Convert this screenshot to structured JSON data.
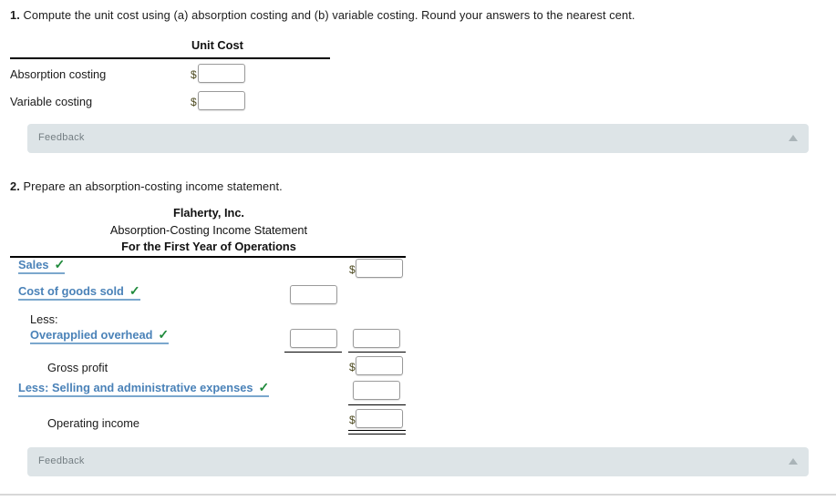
{
  "question1": {
    "number": "1.",
    "prompt": "Compute the unit cost using (a) absorption costing and (b) variable costing. Round your answers to the nearest cent.",
    "column_header": "Unit Cost",
    "rows": [
      {
        "label": "Absorption costing",
        "currency": "$",
        "value": ""
      },
      {
        "label": "Variable costing",
        "currency": "$",
        "value": ""
      }
    ],
    "feedback": {
      "label": "Feedback",
      "caret_icon": "triangle-up-icon"
    }
  },
  "question2": {
    "number": "2.",
    "prompt": "Prepare an absorption-costing income statement.",
    "statement": {
      "company": "Flaherty, Inc.",
      "title": "Absorption-Costing Income Statement",
      "period": "For the First Year of Operations"
    },
    "lines": [
      {
        "key": "sales",
        "label": "Sales",
        "style": "blue",
        "checked": true,
        "check_icon": "check-mark-icon",
        "currency": "$",
        "value": ""
      },
      {
        "key": "cogs",
        "label": "Cost of goods sold",
        "style": "blue",
        "checked": true,
        "check_icon": "check-mark-icon",
        "currency": "",
        "value": ""
      },
      {
        "key": "less",
        "label": "Less:",
        "style": "plain",
        "checked": false,
        "currency": "",
        "value": ""
      },
      {
        "key": "overapplied",
        "label": "Overapplied overhead",
        "style": "blue",
        "checked": true,
        "check_icon": "check-mark-icon",
        "currency": "",
        "value": ""
      },
      {
        "key": "gross_profit",
        "label": "Gross profit",
        "style": "plain",
        "checked": false,
        "currency": "$",
        "value": ""
      },
      {
        "key": "sga",
        "label": "Less: Selling and administrative expenses",
        "style": "blue",
        "checked": true,
        "check_icon": "check-mark-icon",
        "currency": "",
        "value": ""
      },
      {
        "key": "operating_income",
        "label": "Operating income",
        "style": "plain",
        "checked": false,
        "currency": "$",
        "value": ""
      }
    ],
    "feedback": {
      "label": "Feedback",
      "caret_icon": "triangle-up-icon"
    }
  },
  "colors": {
    "link_blue": "#4a82b8",
    "check_green": "#1f8a3b",
    "feedback_bg": "#dde4e7",
    "feedback_text": "#737d82",
    "rule_black": "#000000"
  }
}
